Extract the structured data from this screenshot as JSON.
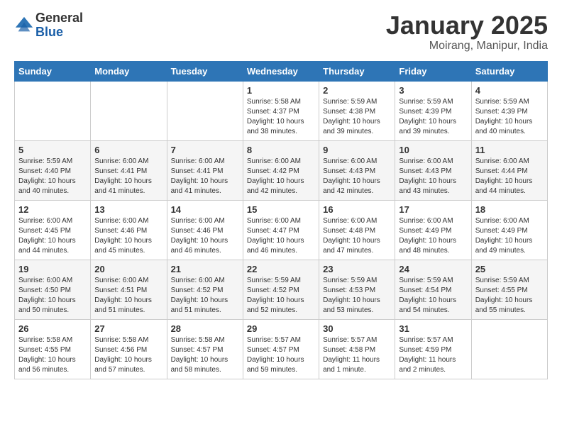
{
  "header": {
    "logo_general": "General",
    "logo_blue": "Blue",
    "month_title": "January 2025",
    "subtitle": "Moirang, Manipur, India"
  },
  "days_of_week": [
    "Sunday",
    "Monday",
    "Tuesday",
    "Wednesday",
    "Thursday",
    "Friday",
    "Saturday"
  ],
  "weeks": [
    [
      {
        "day": "",
        "info": ""
      },
      {
        "day": "",
        "info": ""
      },
      {
        "day": "",
        "info": ""
      },
      {
        "day": "1",
        "info": "Sunrise: 5:58 AM\nSunset: 4:37 PM\nDaylight: 10 hours\nand 38 minutes."
      },
      {
        "day": "2",
        "info": "Sunrise: 5:59 AM\nSunset: 4:38 PM\nDaylight: 10 hours\nand 39 minutes."
      },
      {
        "day": "3",
        "info": "Sunrise: 5:59 AM\nSunset: 4:39 PM\nDaylight: 10 hours\nand 39 minutes."
      },
      {
        "day": "4",
        "info": "Sunrise: 5:59 AM\nSunset: 4:39 PM\nDaylight: 10 hours\nand 40 minutes."
      }
    ],
    [
      {
        "day": "5",
        "info": "Sunrise: 5:59 AM\nSunset: 4:40 PM\nDaylight: 10 hours\nand 40 minutes."
      },
      {
        "day": "6",
        "info": "Sunrise: 6:00 AM\nSunset: 4:41 PM\nDaylight: 10 hours\nand 41 minutes."
      },
      {
        "day": "7",
        "info": "Sunrise: 6:00 AM\nSunset: 4:41 PM\nDaylight: 10 hours\nand 41 minutes."
      },
      {
        "day": "8",
        "info": "Sunrise: 6:00 AM\nSunset: 4:42 PM\nDaylight: 10 hours\nand 42 minutes."
      },
      {
        "day": "9",
        "info": "Sunrise: 6:00 AM\nSunset: 4:43 PM\nDaylight: 10 hours\nand 42 minutes."
      },
      {
        "day": "10",
        "info": "Sunrise: 6:00 AM\nSunset: 4:43 PM\nDaylight: 10 hours\nand 43 minutes."
      },
      {
        "day": "11",
        "info": "Sunrise: 6:00 AM\nSunset: 4:44 PM\nDaylight: 10 hours\nand 44 minutes."
      }
    ],
    [
      {
        "day": "12",
        "info": "Sunrise: 6:00 AM\nSunset: 4:45 PM\nDaylight: 10 hours\nand 44 minutes."
      },
      {
        "day": "13",
        "info": "Sunrise: 6:00 AM\nSunset: 4:46 PM\nDaylight: 10 hours\nand 45 minutes."
      },
      {
        "day": "14",
        "info": "Sunrise: 6:00 AM\nSunset: 4:46 PM\nDaylight: 10 hours\nand 46 minutes."
      },
      {
        "day": "15",
        "info": "Sunrise: 6:00 AM\nSunset: 4:47 PM\nDaylight: 10 hours\nand 46 minutes."
      },
      {
        "day": "16",
        "info": "Sunrise: 6:00 AM\nSunset: 4:48 PM\nDaylight: 10 hours\nand 47 minutes."
      },
      {
        "day": "17",
        "info": "Sunrise: 6:00 AM\nSunset: 4:49 PM\nDaylight: 10 hours\nand 48 minutes."
      },
      {
        "day": "18",
        "info": "Sunrise: 6:00 AM\nSunset: 4:49 PM\nDaylight: 10 hours\nand 49 minutes."
      }
    ],
    [
      {
        "day": "19",
        "info": "Sunrise: 6:00 AM\nSunset: 4:50 PM\nDaylight: 10 hours\nand 50 minutes."
      },
      {
        "day": "20",
        "info": "Sunrise: 6:00 AM\nSunset: 4:51 PM\nDaylight: 10 hours\nand 51 minutes."
      },
      {
        "day": "21",
        "info": "Sunrise: 6:00 AM\nSunset: 4:52 PM\nDaylight: 10 hours\nand 51 minutes."
      },
      {
        "day": "22",
        "info": "Sunrise: 5:59 AM\nSunset: 4:52 PM\nDaylight: 10 hours\nand 52 minutes."
      },
      {
        "day": "23",
        "info": "Sunrise: 5:59 AM\nSunset: 4:53 PM\nDaylight: 10 hours\nand 53 minutes."
      },
      {
        "day": "24",
        "info": "Sunrise: 5:59 AM\nSunset: 4:54 PM\nDaylight: 10 hours\nand 54 minutes."
      },
      {
        "day": "25",
        "info": "Sunrise: 5:59 AM\nSunset: 4:55 PM\nDaylight: 10 hours\nand 55 minutes."
      }
    ],
    [
      {
        "day": "26",
        "info": "Sunrise: 5:58 AM\nSunset: 4:55 PM\nDaylight: 10 hours\nand 56 minutes."
      },
      {
        "day": "27",
        "info": "Sunrise: 5:58 AM\nSunset: 4:56 PM\nDaylight: 10 hours\nand 57 minutes."
      },
      {
        "day": "28",
        "info": "Sunrise: 5:58 AM\nSunset: 4:57 PM\nDaylight: 10 hours\nand 58 minutes."
      },
      {
        "day": "29",
        "info": "Sunrise: 5:57 AM\nSunset: 4:57 PM\nDaylight: 10 hours\nand 59 minutes."
      },
      {
        "day": "30",
        "info": "Sunrise: 5:57 AM\nSunset: 4:58 PM\nDaylight: 11 hours\nand 1 minute."
      },
      {
        "day": "31",
        "info": "Sunrise: 5:57 AM\nSunset: 4:59 PM\nDaylight: 11 hours\nand 2 minutes."
      },
      {
        "day": "",
        "info": ""
      }
    ]
  ]
}
